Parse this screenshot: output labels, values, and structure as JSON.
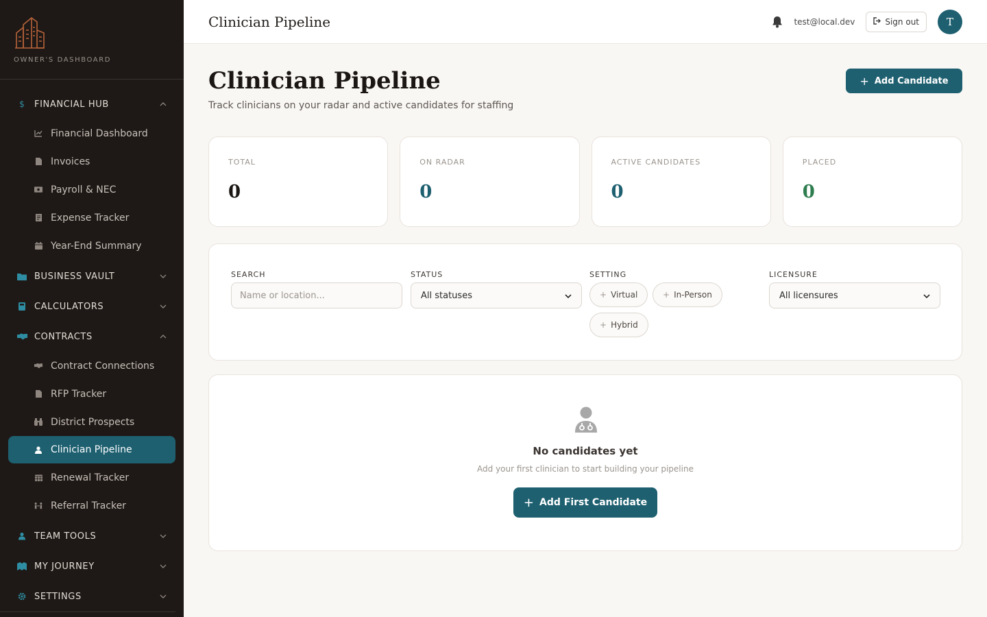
{
  "sidebar": {
    "logo_caption": "OWNER'S DASHBOARD",
    "sections": {
      "financial_hub": {
        "label": "FINANCIAL HUB",
        "icon": "dollar-icon",
        "items": [
          "Financial Dashboard",
          "Invoices",
          "Payroll & NEC",
          "Expense Tracker",
          "Year-End Summary"
        ]
      },
      "business_vault": {
        "label": "BUSINESS VAULT",
        "icon": "folder-icon"
      },
      "calculators": {
        "label": "CALCULATORS",
        "icon": "calculator-icon"
      },
      "contracts": {
        "label": "CONTRACTS",
        "icon": "handshake-icon",
        "items": [
          "Contract Connections",
          "RFP Tracker",
          "District Prospects",
          "Clinician Pipeline",
          "Renewal Tracker",
          "Referral Tracker"
        ]
      },
      "team_tools": {
        "label": "TEAM TOOLS",
        "icon": "person-icon"
      },
      "my_journey": {
        "label": "MY JOURNEY",
        "icon": "map-icon"
      },
      "settings": {
        "label": "SETTINGS",
        "icon": "gear-icon"
      }
    },
    "active_item": "Clinician Pipeline"
  },
  "topbar": {
    "title": "Clinician Pipeline",
    "user_email": "test@local.dev",
    "sign_out_label": "Sign out",
    "avatar_initial": "T"
  },
  "main": {
    "title": "Clinician Pipeline",
    "subtitle": "Track clinicians on your radar and active candidates for staffing",
    "add_button": "Add Candidate",
    "stats": [
      {
        "label": "TOTAL",
        "value": "0",
        "color": "#1a1613"
      },
      {
        "label": "ON RADAR",
        "value": "0",
        "color": "#1e6070"
      },
      {
        "label": "ACTIVE CANDIDATES",
        "value": "0",
        "color": "#1e6070"
      },
      {
        "label": "PLACED",
        "value": "0",
        "color": "#2e7d4f"
      }
    ],
    "filters": {
      "search_label": "SEARCH",
      "search_placeholder": "Name or location...",
      "status_label": "STATUS",
      "status_value": "All statuses",
      "setting_label": "SETTING",
      "setting_options": [
        "Virtual",
        "In-Person",
        "Hybrid"
      ],
      "licensure_label": "LICENSURE",
      "licensure_value": "All licensures"
    },
    "empty": {
      "title": "No candidates yet",
      "subtitle": "Add your first clinician to start building your pipeline",
      "button": "Add First Candidate"
    }
  },
  "colors": {
    "accent": "#1e6070",
    "sidebar_bg": "#1e1916",
    "logo": "#b8643a"
  }
}
